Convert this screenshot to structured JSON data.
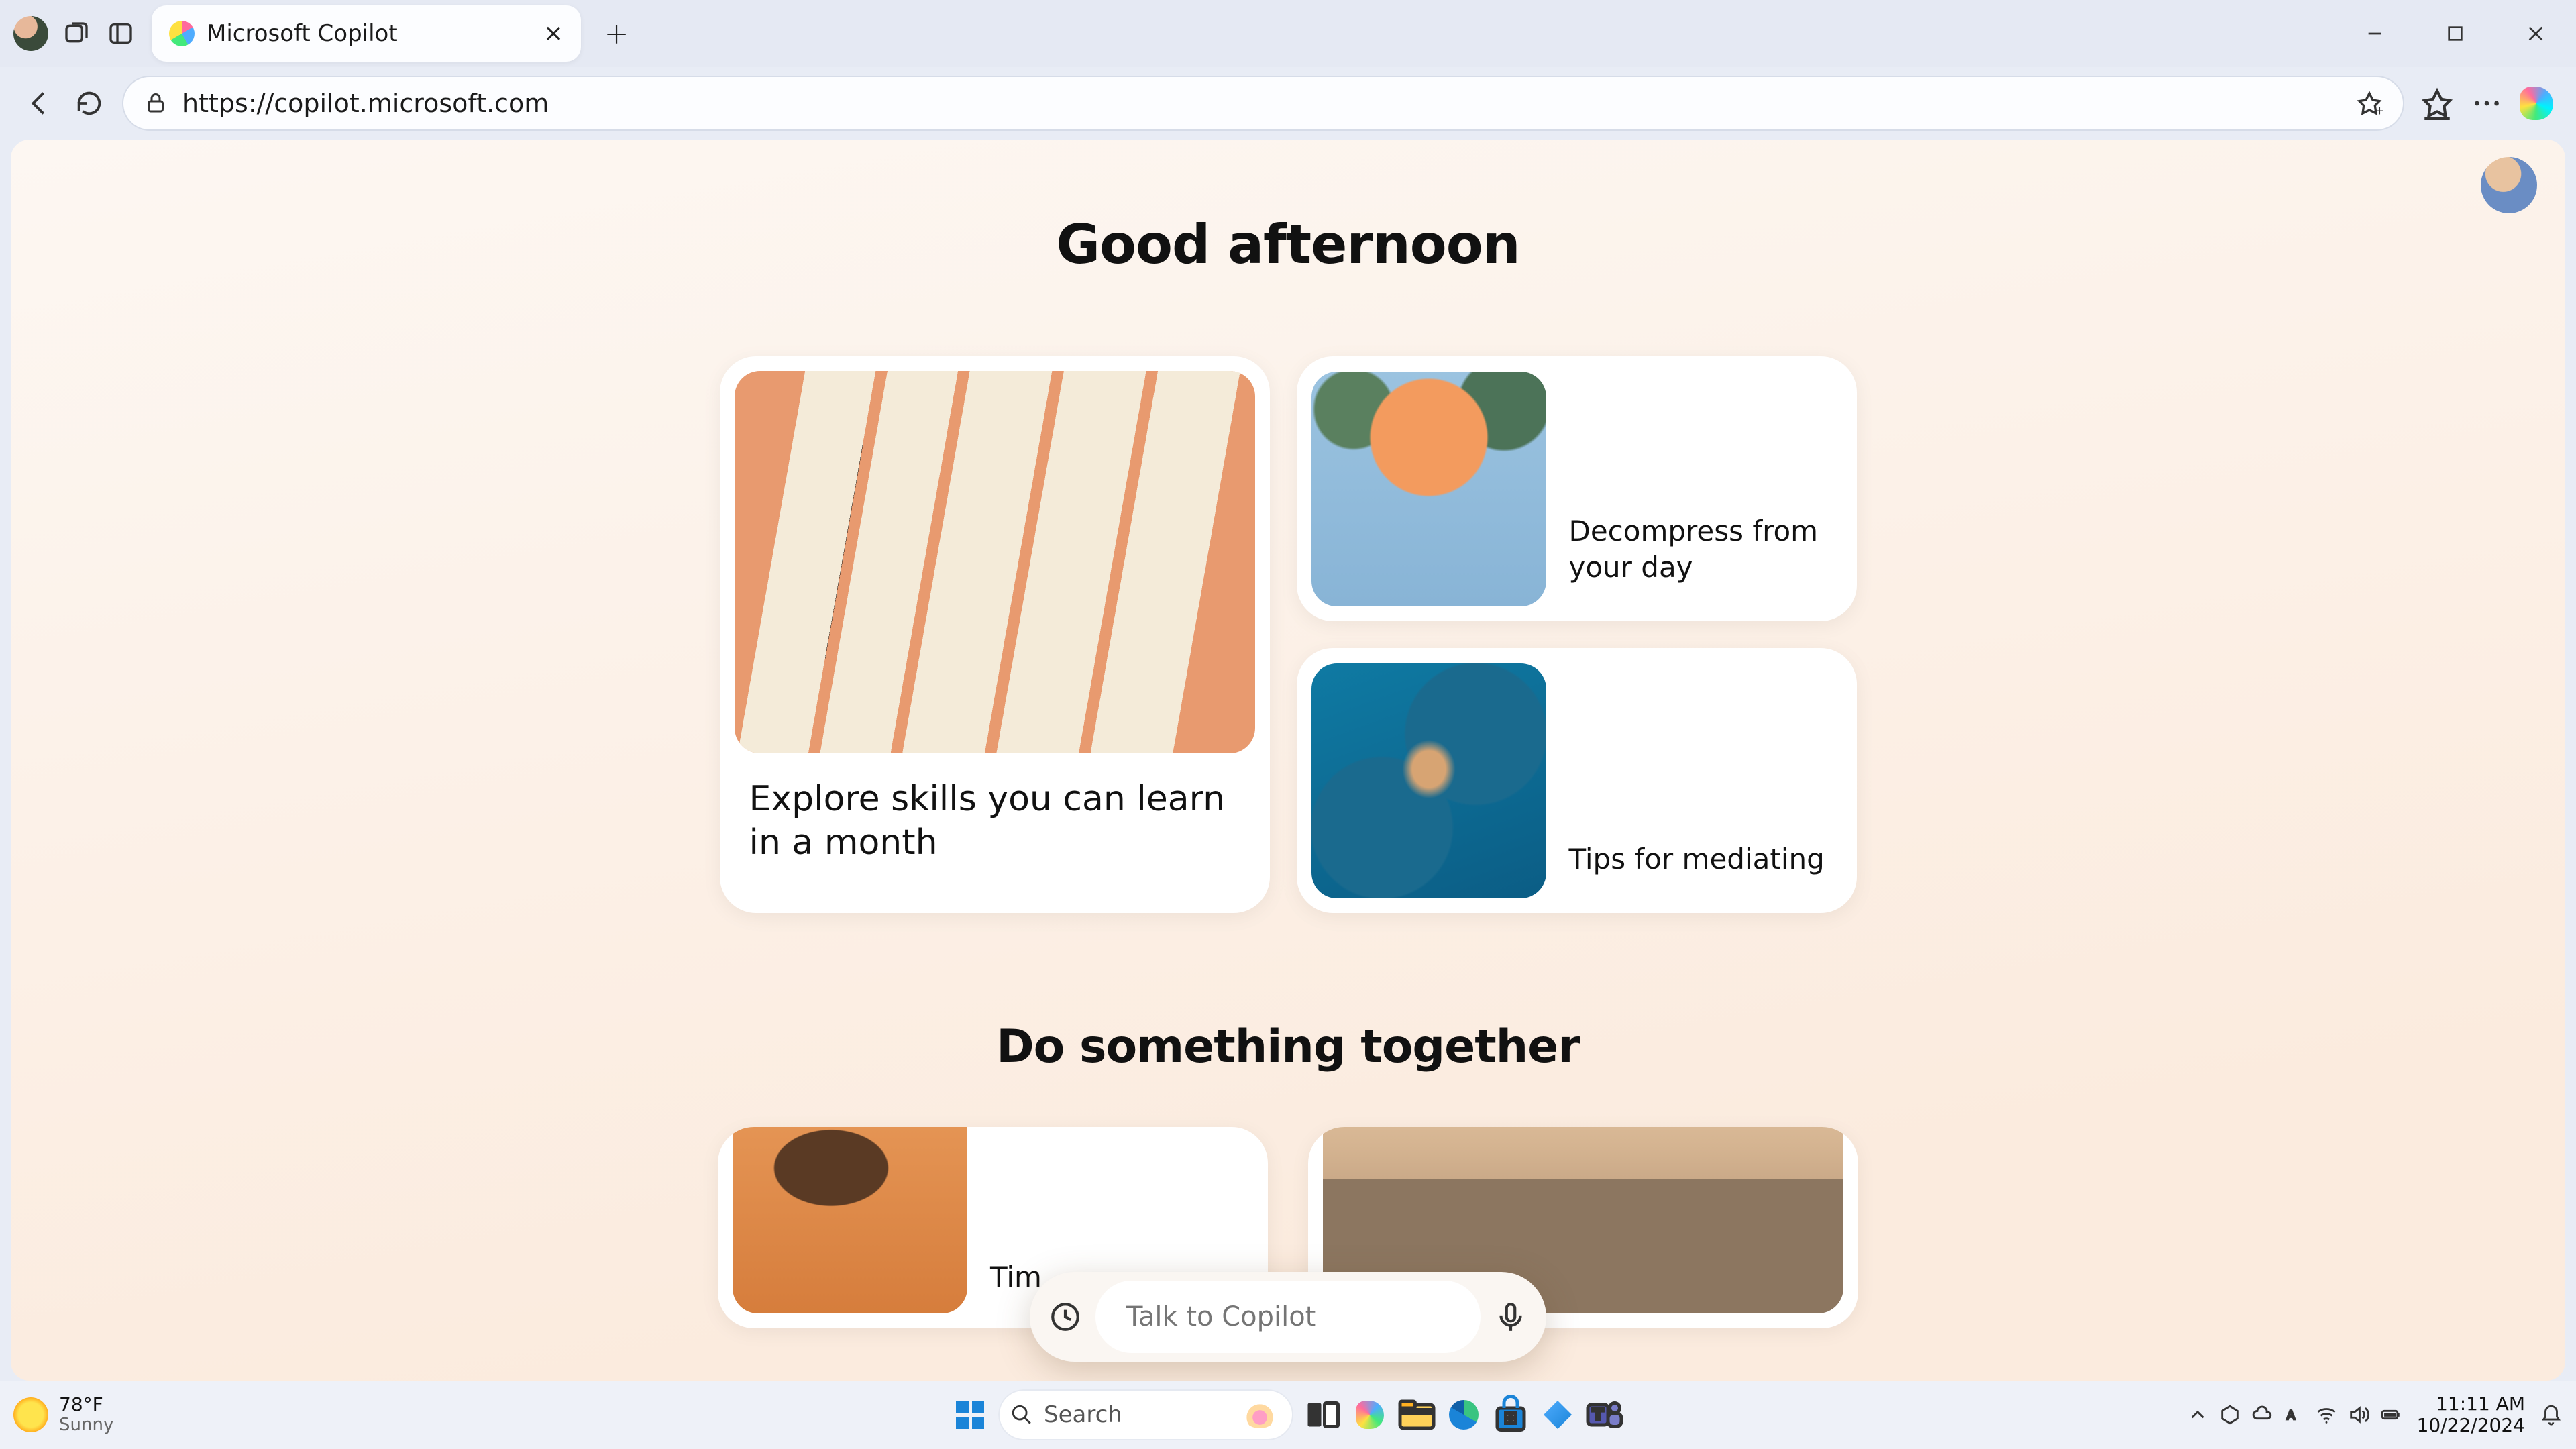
{
  "browser": {
    "tab_title": "Microsoft Copilot",
    "url": "https://copilot.microsoft.com"
  },
  "page": {
    "greeting": "Good afternoon",
    "cards_primary": {
      "large": "Explore skills you can learn in a month",
      "small": [
        "Decompress from your day",
        "Tips for mediating"
      ]
    },
    "section2_heading": "Do something together",
    "cards_secondary": [
      "Tim",
      ""
    ],
    "composer_placeholder": "Talk to Copilot"
  },
  "taskbar": {
    "weather_temp": "78°F",
    "weather_cond": "Sunny",
    "search_label": "Search",
    "clock_time": "11:11 AM",
    "clock_date": "10/22/2024"
  }
}
